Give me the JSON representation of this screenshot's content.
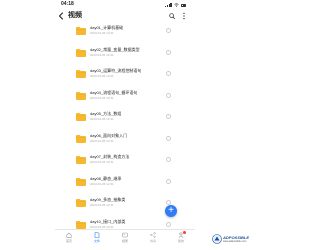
{
  "status_bar": {
    "time": "04:18"
  },
  "header": {
    "title": "视频",
    "back_icon": "chevron-left-icon",
    "search_icon": "search-icon",
    "more_icon": "more-vertical-icon"
  },
  "colors": {
    "accent": "#2f7cf6",
    "folder": "#f5b82e",
    "badge": "#ff3b30"
  },
  "files": [
    {
      "name": "day01_计算机基础",
      "sub": "2023-03-05 12:31"
    },
    {
      "name": "day02_常量_变量_数据类型",
      "sub": "2023-03-05 12:31"
    },
    {
      "name": "day03_运算符_流程控制语句",
      "sub": "2023-03-05 12:31"
    },
    {
      "name": "day04_流程语句_循环语句",
      "sub": "2023-03-05 12:31"
    },
    {
      "name": "day05_方法_数组",
      "sub": "2023-03-05 12:31"
    },
    {
      "name": "day06_面向对象入门",
      "sub": "2023-03-05 12:31"
    },
    {
      "name": "day07_封装_构造方法",
      "sub": "2023-03-05 12:31"
    },
    {
      "name": "day08_静态_继承",
      "sub": "2023-03-05 12:31"
    },
    {
      "name": "day09_多态_抽象类",
      "sub": "2023-03-05 12:31"
    },
    {
      "name": "day10_接口_内部类",
      "sub": "2023-03-05 12:31"
    }
  ],
  "fab": {
    "label": "+"
  },
  "bottom_nav": [
    {
      "label": "首页",
      "icon": "home-icon",
      "active": false
    },
    {
      "label": "文件",
      "icon": "file-icon",
      "active": true
    },
    {
      "label": "相册",
      "icon": "photo-icon",
      "active": false
    },
    {
      "label": "共享",
      "icon": "share-icon",
      "active": false
    },
    {
      "label": "我的",
      "icon": "user-icon",
      "active": false
    }
  ],
  "watermark": {
    "text": "ADPOSSIBLE",
    "sub": "www.adpossible.com"
  }
}
